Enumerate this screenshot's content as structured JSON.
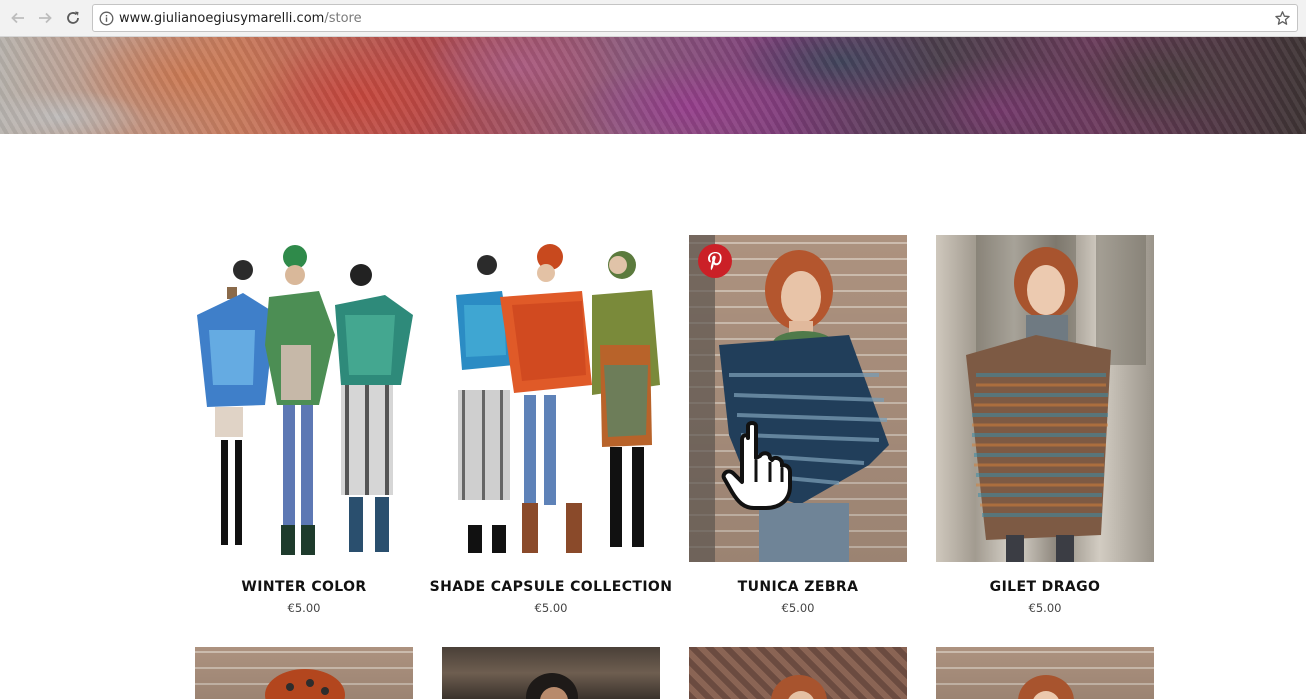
{
  "browser": {
    "url_host": "www.giulianoegiusymarelli.com",
    "url_path": "/store"
  },
  "products": [
    {
      "name": "WINTER COLOR",
      "price": "€5.00"
    },
    {
      "name": "SHADE CAPSULE COLLECTION",
      "price": "€5.00"
    },
    {
      "name": "TUNICA ZEBRA",
      "price": "€5.00"
    },
    {
      "name": "GILET DRAGO",
      "price": "€5.00"
    }
  ],
  "icons": {
    "back": "arrow-left-icon",
    "forward": "arrow-right-icon",
    "reload": "reload-icon",
    "info": "info-icon",
    "bookmark": "star-icon",
    "pin": "pinterest-icon",
    "cursor": "hand-pointer-icon"
  },
  "colors": {
    "pinterest": "#cb2027"
  }
}
